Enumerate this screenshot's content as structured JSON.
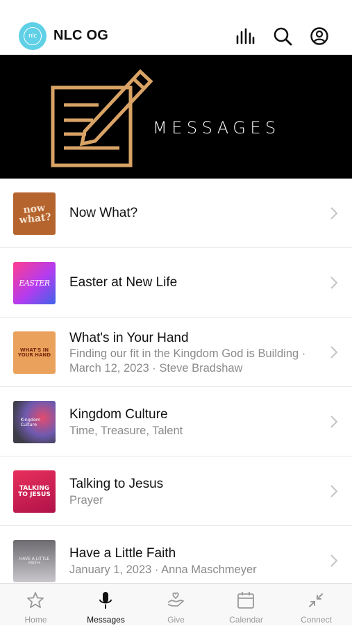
{
  "header": {
    "logo_text": "nlc",
    "app_title": "NLC OG",
    "icons": [
      "stats-icon",
      "search-icon",
      "profile-icon"
    ]
  },
  "banner": {
    "title": "MESSAGES",
    "colors": {
      "background": "#000000",
      "accent": "#d9a366"
    }
  },
  "messages": [
    {
      "title": "Now What?",
      "subtitle": "",
      "thumb_text": "now what?"
    },
    {
      "title": "Easter at New Life",
      "subtitle": "",
      "thumb_text": "EASTER"
    },
    {
      "title": "What's in Your Hand",
      "subtitle": "Finding our fit in the Kingdom God is Building · March 12, 2023 · Steve Bradshaw",
      "thumb_text": "WHAT'S IN YOUR HAND"
    },
    {
      "title": "Kingdom Culture",
      "subtitle": "Time, Treasure, Talent",
      "thumb_text": "Kingdom Culture"
    },
    {
      "title": "Talking to Jesus",
      "subtitle": "Prayer",
      "thumb_text": "TALKING TO JESUS"
    },
    {
      "title": "Have a Little Faith",
      "subtitle": "January 1, 2023 · Anna Maschmeyer",
      "thumb_text": "HAVE A LITTLE FAITH"
    }
  ],
  "tabs": [
    {
      "label": "Home",
      "icon": "star-icon",
      "active": false
    },
    {
      "label": "Messages",
      "icon": "microphone-icon",
      "active": true
    },
    {
      "label": "Give",
      "icon": "give-hand-heart-icon",
      "active": false
    },
    {
      "label": "Calendar",
      "icon": "calendar-icon",
      "active": false
    },
    {
      "label": "Connect",
      "icon": "collapse-arrows-icon",
      "active": false
    }
  ]
}
